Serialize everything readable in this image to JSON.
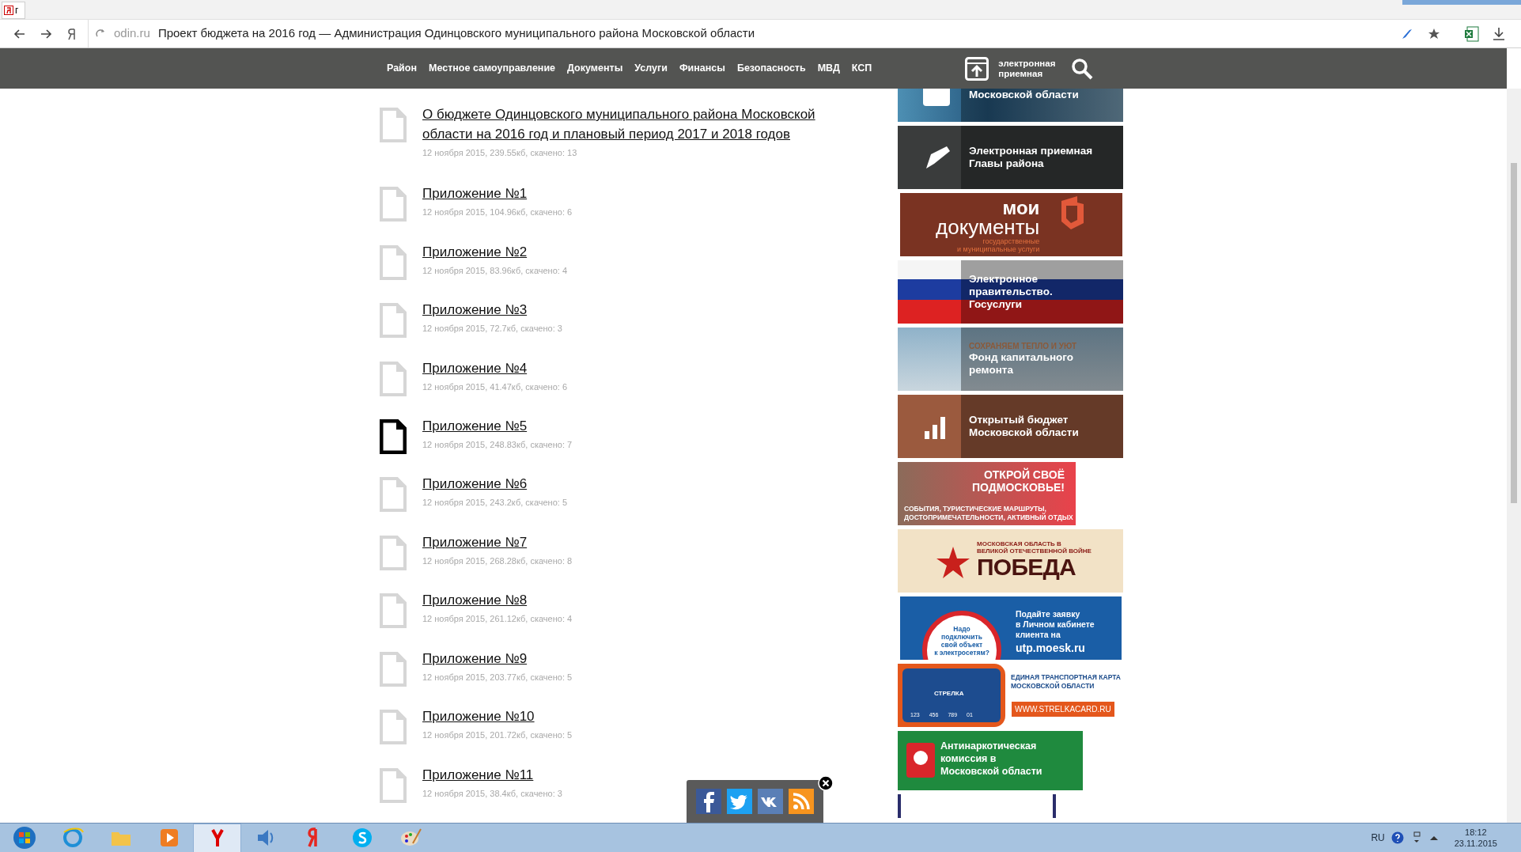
{
  "browser": {
    "tab": {
      "title": "г"
    },
    "address": {
      "domain": "odin.ru",
      "title": "Проект бюджета на 2016 год — Администрация Одинцовского муниципального района Московской области"
    }
  },
  "nav": {
    "items": [
      "Район",
      "Местное самоуправление",
      "Документы",
      "Услуги",
      "Финансы",
      "Безопасность",
      "МВД",
      "КСП"
    ],
    "reception": "электронная приемная"
  },
  "documents": [
    {
      "title": "О бюджете Одинцовского муниципального района Московской области на 2016 год и плановый период 2017 и 2018 годов",
      "meta": "12 ноября 2015, 239.55кб, скачено: 13",
      "hovered": false
    },
    {
      "title": "Приложение №1",
      "meta": "12 ноября 2015, 104.96кб, скачено: 6",
      "hovered": false
    },
    {
      "title": "Приложение №2",
      "meta": "12 ноября 2015, 83.96кб, скачено: 4",
      "hovered": false
    },
    {
      "title": "Приложение №3",
      "meta": "12 ноября 2015, 72.7кб, скачено: 3",
      "hovered": false
    },
    {
      "title": "Приложение №4",
      "meta": "12 ноября 2015, 41.47кб, скачено: 6",
      "hovered": false
    },
    {
      "title": "Приложение №5",
      "meta": "12 ноября 2015, 248.83кб, скачено: 7",
      "hovered": true
    },
    {
      "title": "Приложение №6",
      "meta": "12 ноября 2015, 243.2кб, скачено: 5",
      "hovered": false
    },
    {
      "title": "Приложение №7",
      "meta": "12 ноября 2015, 268.28кб, скачено: 8",
      "hovered": false
    },
    {
      "title": "Приложение №8",
      "meta": "12 ноября 2015, 261.12кб, скачено: 4",
      "hovered": false
    },
    {
      "title": "Приложение №9",
      "meta": "12 ноября 2015, 203.77кб, скачено: 5",
      "hovered": false
    },
    {
      "title": "Приложение №10",
      "meta": "12 ноября 2015, 201.72кб, скачено: 5",
      "hovered": false
    },
    {
      "title": "Приложение №11",
      "meta": "12 ноября 2015, 38.4кб, скачено: 3",
      "hovered": false
    }
  ],
  "banners": [
    {
      "kind": "photo",
      "lines": [
        "Московской области"
      ]
    },
    {
      "kind": "keyboard",
      "lines": [
        "Электронная приемная",
        "Главы района"
      ]
    },
    {
      "kind": "moi",
      "lines": [
        "мои",
        "документы",
        "государственные",
        "и муниципальные услуги"
      ]
    },
    {
      "kind": "flag",
      "lines": [
        "Электронное",
        "правительство.",
        "Госуслуги"
      ]
    },
    {
      "kind": "sky",
      "lines": [
        "СОХРАНЯЕМ ТЕПЛО И УЮТ",
        "Фонд капитального",
        "ремонта"
      ]
    },
    {
      "kind": "money",
      "lines": [
        "Открытый бюджет",
        "Московской области"
      ]
    },
    {
      "kind": "tourism",
      "lines": [
        "ОТКРОЙ СВОЁ",
        "ПОДМОСКОВЬЕ!",
        "СОБЫТИЯ, ТУРИСТИЧЕСКИЕ МАРШРУТЫ,",
        "ДОСТОПРИМЕЧАТЕЛЬНОСТИ, АКТИВНЫЙ ОТДЫХ"
      ]
    },
    {
      "kind": "pobeda",
      "lines": [
        "МОСКОВСКАЯ ОБЛАСТЬ В",
        "ВЕЛИКОЙ ОТЕЧЕСТВЕННОЙ ВОЙНЕ",
        "ПОБЕДА"
      ]
    },
    {
      "kind": "moesk",
      "lines": [
        "Надо",
        "подключить",
        "свой объект",
        "к электросетям?",
        "Подайте заявку",
        "в Личном кабинете",
        "клиента на",
        "utp.moesk.ru"
      ]
    },
    {
      "kind": "strelka",
      "lines": [
        "СТРЕЛКА",
        "123",
        "456",
        "789",
        "01",
        "ЕДИНАЯ ТРАНСПОРТНАЯ КАРТА",
        "МОСКОВСКОЙ ОБЛАСТИ",
        "WWW.STRELKACARD.RU"
      ]
    },
    {
      "kind": "antinarko",
      "lines": [
        "Антинаркотическая",
        "комиссия в",
        "Московской области"
      ]
    },
    {
      "kind": "cut"
    }
  ],
  "tray": {
    "language": "RU",
    "time": "18:12",
    "date": "23.11.2015"
  }
}
